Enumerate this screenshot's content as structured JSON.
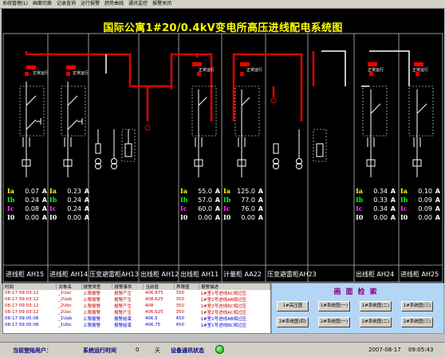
{
  "menu": [
    "系统管理(L)",
    "画面切换",
    "记录查询",
    "运行报警",
    "趋势曲线",
    "通讯监控",
    "报警关闭"
  ],
  "title": "国际公寓1#20/0.4kV变电所高压进线配电系统图",
  "status_label": "正常运行",
  "cabinets": [
    "进线柜 AH15",
    "进线柜 AH14",
    "压变避雷柜AH13",
    "出线柜 AH12",
    "出线柜 AH11",
    "计量柜 AA22",
    "压变避雷柜AH23",
    "出线柜 AH24",
    "进线柜 AH25"
  ],
  "meter_names": [
    "Ia",
    "Ib",
    "Ic",
    "I0"
  ],
  "meter_unit": "A",
  "meters": [
    {
      "id": "AH15",
      "values": [
        "0.07",
        "0.24",
        "0.08",
        "0.00"
      ]
    },
    {
      "id": "AH14",
      "values": [
        "0.23",
        "0.24",
        "0.24",
        "0.00"
      ]
    },
    {
      "id": "AH12",
      "values": [
        "55.0",
        "57.0",
        "60.0",
        "0.00"
      ]
    },
    {
      "id": "AH11",
      "values": [
        "125.0",
        "77.0",
        "76.0",
        "0.00"
      ]
    },
    {
      "id": "AH24",
      "values": [
        "0.34",
        "0.33",
        "0.34",
        "0.00"
      ]
    },
    {
      "id": "AH25",
      "values": [
        "0.10",
        "0.09",
        "0.09",
        "0.00"
      ]
    }
  ],
  "alarm_headers": [
    "时间",
    "对象名",
    "报警类型",
    "报警事件",
    "当前值",
    "界限值",
    "报警描述"
  ],
  "alarms": [
    [
      "08-17 09:03:12",
      "_1Uac",
      "上限报警",
      "报警产生",
      "406.875",
      "350",
      "1#室1号进线AC相过压"
    ],
    [
      "08-17 09:03:12",
      "_2Uab",
      "上限报警",
      "报警产生",
      "408.625",
      "350",
      "1#室2号进线AB相过压"
    ],
    [
      "08-17 09:03:12",
      "_2Ubc",
      "上限报警",
      "报警产生",
      "408",
      "350",
      "1#室2号进线BC相过压"
    ],
    [
      "08-17 09:03:12",
      "_2Uac",
      "上限报警",
      "报警产生",
      "406.625",
      "350",
      "1#室2号进线AC相过压"
    ],
    [
      "08-17 09:05:08",
      "_1Uab",
      "上限报警",
      "报警结束",
      "406.5",
      "450",
      "1#室1号进线AB相过压"
    ],
    [
      "08-17 09:05:08",
      "_1Ubc",
      "上限报警",
      "报警结束",
      "406.75",
      "450",
      "1#室1号进线BC相过压"
    ]
  ],
  "query": {
    "title": "画面检索",
    "buttons": [
      "1#高压图",
      "1#系统图(一)",
      "1#系统图(二)",
      "1#系统图(三)",
      "2#系统图(四)",
      "2#系统图(一)",
      "2#系统图(二)",
      "2#系统图(三)"
    ]
  },
  "statusbar": {
    "user_label": "当前登陆用户：",
    "runtime_label": "系统运行时间",
    "runtime_value": "0",
    "runtime_unit": "天",
    "comm_label": "设备通讯状态",
    "date": "2007-08-17",
    "time": "09:05:43"
  },
  "colors": {
    "bus": "#e00000",
    "phase_a": "#ffff00",
    "phase_b": "#00ff00",
    "phase_c": "#ff33ff",
    "background": "#000000"
  }
}
